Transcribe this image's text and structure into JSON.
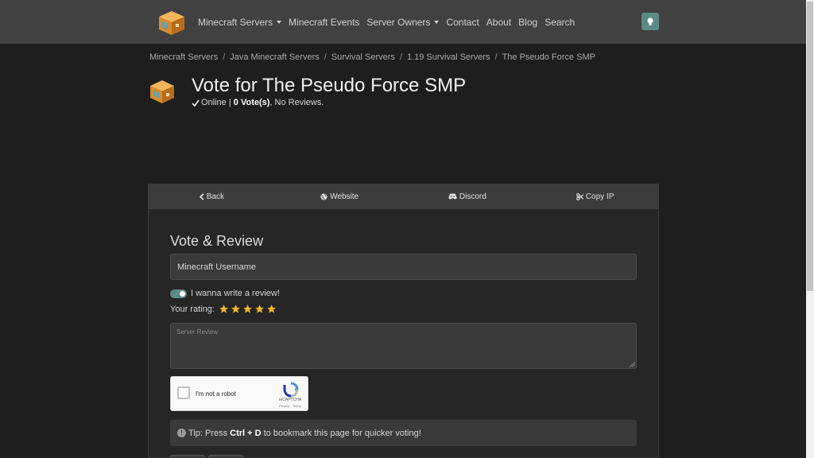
{
  "navbar": {
    "items": [
      {
        "label": "Minecraft Servers",
        "dropdown": true
      },
      {
        "label": "Minecraft Events",
        "dropdown": false
      },
      {
        "label": "Server Owners",
        "dropdown": true
      },
      {
        "label": "Contact",
        "dropdown": false
      },
      {
        "label": "About",
        "dropdown": false
      },
      {
        "label": "Blog",
        "dropdown": false
      },
      {
        "label": "Search",
        "dropdown": false
      }
    ],
    "theme_icon": "lightbulb-icon",
    "theme_color": "#5c8a84"
  },
  "breadcrumb": [
    "Minecraft Servers",
    "Java Minecraft Servers",
    "Survival Servers",
    "1.19 Survival Servers",
    "The Pseudo Force SMP"
  ],
  "header": {
    "title": "Vote for The Pseudo Force SMP",
    "status": "Online",
    "status_sep": " | ",
    "votes": "0 Vote(s)",
    "reviews": ", No Reviews."
  },
  "tabs": [
    {
      "label": "Back",
      "icon": "chevron-left-icon"
    },
    {
      "label": "Website",
      "icon": "globe-icon"
    },
    {
      "label": "Discord",
      "icon": "discord-icon"
    },
    {
      "label": "Copy IP",
      "icon": "scissors-icon"
    }
  ],
  "form": {
    "title": "Vote & Review",
    "username_placeholder": "Minecraft Username",
    "toggle_label": "I wanna write a review!",
    "toggle_on": true,
    "rating_label": "Your rating:",
    "rating_stars": 5,
    "rating_max": 5,
    "review_placeholder": "Server Review",
    "star_color": "#f0b429"
  },
  "recaptcha": {
    "label": "I'm not a robot",
    "brand": "reCAPTCHA",
    "terms": "Privacy - Terms"
  },
  "tip": {
    "prefix": "Tip: Press ",
    "keys": "Ctrl + D",
    "suffix": " to bookmark this page for quicker voting!"
  }
}
